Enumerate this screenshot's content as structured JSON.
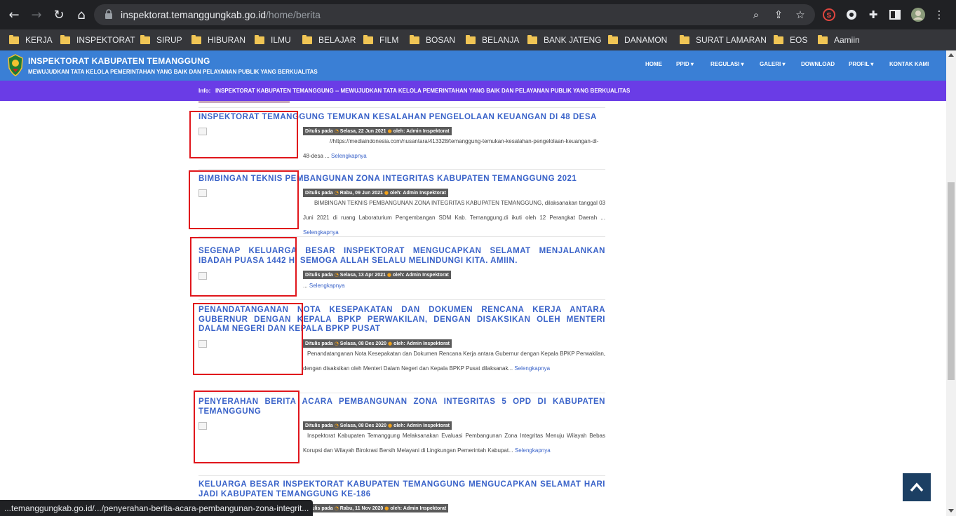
{
  "browser": {
    "url_domain": "inspektorat.temanggungkab.go.id",
    "url_path": "/home/berita",
    "status_url": "...temanggungkab.go.id/.../penyerahan-berita-acara-pembangunan-zona-integrit..."
  },
  "bookmarks": [
    "KERJA",
    "INSPEKTORAT",
    "SIRUP",
    "HIBURAN",
    "ILMU",
    "BELAJAR",
    "FILM",
    "BOSAN",
    "BELANJA",
    "BANK JATENG",
    "DANAMON",
    "SURAT LAMARAN",
    "EOS",
    "Aamiin"
  ],
  "site": {
    "title": "INSPEKTORAT KABUPATEN TEMANGGUNG",
    "tagline": "MEWUJUDKAN TATA KELOLA PEMERINTAHAN YANG BAIK DAN PELAYANAN PUBLIK YANG BERKUALITAS",
    "nav": [
      "HOME",
      "PPID ▾",
      "REGULASI ▾",
      "GALERI ▾",
      "DOWNLOAD",
      "PROFIL ▾",
      "KONTAK KAMI"
    ],
    "info_label": "Info:",
    "info_text": "INSPEKTORAT KABUPATEN TEMANGGUNG -- MEWUJUDKAN TATA KELOLA PEMERINTAHAN YANG BAIK DAN PELAYANAN PUBLIK YANG BERKUALITAS"
  },
  "meta": {
    "written_label": "Ditulis pada",
    "author": "oleh: Admin Inspektorat",
    "more": "Selengkapnya"
  },
  "articles": [
    {
      "title": "INSPEKTORAT TEMANGGUNG TEMUKAN KESALAHAN PENGELOLAAN KEUANGAN DI 48 DESA",
      "date": "Selasa, 22 Jun 2021",
      "excerpt": "//https://mediaindonesia.com/nusantara/413328/temanggung-temukan-kesalahan-pengelolaan-keuangan-di-48-desa ..."
    },
    {
      "title": "BIMBINGAN TEKNIS PEMBANGUNAN ZONA INTEGRITAS KABUPATEN TEMANGGUNG 2021",
      "date": "Rabu, 09 Jun 2021",
      "excerpt": "BIMBINGAN TEKNIS PEMBANGUNAN ZONA INTEGRITAS KABUPATEN TEMANGGUNG, dilaksanakan tanggal 03 Juni 2021 di ruang Laboraturium Pengembangan SDM Kab. Temanggung.di ikuti oleh 12 Perangkat Daerah ..."
    },
    {
      "title": "SEGENAP KELUARGA BESAR INSPEKTORAT MENGUCAPKAN SELAMAT MENJALANKAN IBADAH PUASA 1442 H. SEMOGA ALLAH SELALU MELINDUNGI KITA. AMIIN.",
      "date": "Selasa, 13 Apr 2021",
      "excerpt": "..."
    },
    {
      "title": "PENANDATANGANAN NOTA KESEPAKATAN DAN DOKUMEN RENCANA KERJA ANTARA GUBERNUR DENGAN KEPALA BPKP PERWAKILAN, DENGAN DISAKSIKAN OLEH MENTERI DALAM NEGERI DAN KEPALA BPKP PUSAT",
      "date": "Selasa, 08 Des 2020",
      "excerpt": "Penandatanganan Nota Kesepakatan dan Dokumen Rencana Kerja antara Gubernur dengan Kepala BPKP Perwakilan, dengan disaksikan oleh  Menteri Dalam Negeri dan Kepala BPKP Pusat dilaksanak..."
    },
    {
      "title": "PENYERAHAN BERITA ACARA PEMBANGUNAN ZONA INTEGRITAS 5 OPD DI KABUPATEN TEMANGGUNG",
      "date": "Selasa, 08 Des 2020",
      "excerpt": "Inspektorat Kabupaten Temanggung Melaksanakan Evaluasi Pembangunan Zona Integritas Menuju Wilayah Bebas Korupsi dan Wilayah Birokrasi Bersih Melayani di Lingkungan Pemerintah Kabupat..."
    },
    {
      "title": "KELUARGA BESAR INSPEKTORAT KABUPATEN TEMANGGUNG MENGUCAPKAN SELAMAT HARI JADI KABUPATEN TEMANGGUNG KE-186",
      "date": "Rabu, 11 Nov 2020",
      "excerpt": ""
    }
  ],
  "colors": {
    "header": "#3a7fd5",
    "info_bar": "#6a3ce6",
    "title_link": "#3a63c9",
    "highlight_box": "#e0161c"
  }
}
